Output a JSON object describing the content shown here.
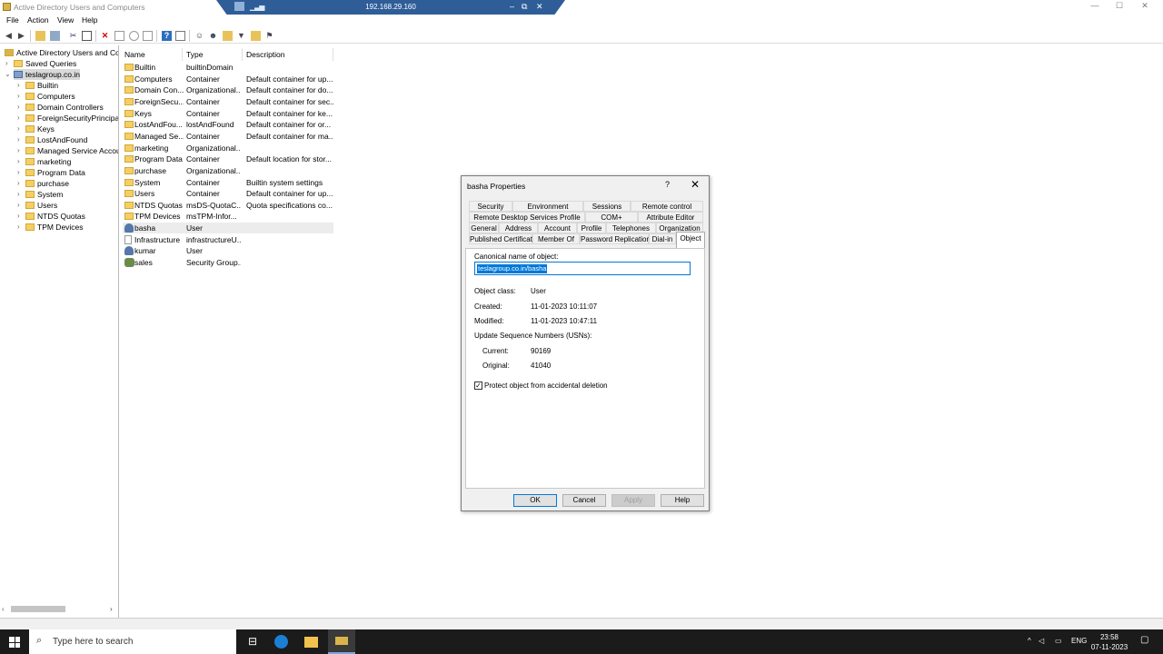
{
  "window": {
    "title": "Active Directory Users and Computers",
    "controls": {
      "minimize": "—",
      "maximize": "☐",
      "close": "✕"
    }
  },
  "rdp_bar": {
    "ip": "192.168.29.160",
    "signal": "▁▃▅",
    "controls": {
      "minimize": "–",
      "restore": "⧉",
      "close": "✕"
    }
  },
  "menu": [
    "File",
    "Action",
    "View",
    "Help"
  ],
  "tree": {
    "root": "Active Directory Users and Com",
    "saved_queries": "Saved Queries",
    "domain": "teslagroup.co.in",
    "children": [
      "Builtin",
      "Computers",
      "Domain Controllers",
      "ForeignSecurityPrincipals",
      "Keys",
      "LostAndFound",
      "Managed Service Accou",
      "marketing",
      "Program Data",
      "purchase",
      "System",
      "Users",
      "NTDS Quotas",
      "TPM Devices"
    ]
  },
  "list": {
    "columns": [
      "Name",
      "Type",
      "Description"
    ],
    "rows": [
      {
        "name": "Builtin",
        "type": "builtinDomain",
        "desc": "",
        "icon": "folder"
      },
      {
        "name": "Computers",
        "type": "Container",
        "desc": "Default container for up...",
        "icon": "folder"
      },
      {
        "name": "Domain Con...",
        "type": "Organizational...",
        "desc": "Default container for do...",
        "icon": "folder"
      },
      {
        "name": "ForeignSecu...",
        "type": "Container",
        "desc": "Default container for sec...",
        "icon": "folder"
      },
      {
        "name": "Keys",
        "type": "Container",
        "desc": "Default container for ke...",
        "icon": "folder"
      },
      {
        "name": "LostAndFou...",
        "type": "lostAndFound",
        "desc": "Default container for or...",
        "icon": "folder"
      },
      {
        "name": "Managed Se...",
        "type": "Container",
        "desc": "Default container for ma...",
        "icon": "folder"
      },
      {
        "name": "marketing",
        "type": "Organizational...",
        "desc": "",
        "icon": "folder"
      },
      {
        "name": "Program Data",
        "type": "Container",
        "desc": "Default location for stor...",
        "icon": "folder"
      },
      {
        "name": "purchase",
        "type": "Organizational...",
        "desc": "",
        "icon": "folder"
      },
      {
        "name": "System",
        "type": "Container",
        "desc": "Builtin system settings",
        "icon": "folder"
      },
      {
        "name": "Users",
        "type": "Container",
        "desc": "Default container for up...",
        "icon": "folder"
      },
      {
        "name": "NTDS Quotas",
        "type": "msDS-QuotaC...",
        "desc": "Quota specifications co...",
        "icon": "folder"
      },
      {
        "name": "TPM Devices",
        "type": "msTPM-Infor...",
        "desc": "",
        "icon": "folder"
      },
      {
        "name": "basha",
        "type": "User",
        "desc": "",
        "icon": "user"
      },
      {
        "name": "Infrastructure",
        "type": "infrastructureU...",
        "desc": "",
        "icon": "doc"
      },
      {
        "name": "kumar",
        "type": "User",
        "desc": "",
        "icon": "user"
      },
      {
        "name": "sales",
        "type": "Security Group...",
        "desc": "",
        "icon": "group"
      }
    ]
  },
  "dialog": {
    "title": "basha Properties",
    "help": "?",
    "close": "✕",
    "tabs_row1": [
      "Security",
      "Environment",
      "Sessions",
      "Remote control"
    ],
    "tabs_row2": [
      "Remote Desktop Services Profile",
      "COM+",
      "Attribute Editor"
    ],
    "tabs_row3": [
      "General",
      "Address",
      "Account",
      "Profile",
      "Telephones",
      "Organization"
    ],
    "tabs_row4": [
      "Published Certificates",
      "Member Of",
      "Password Replication",
      "Dial-in",
      "Object"
    ],
    "canonical_label": "Canonical name of object:",
    "canonical_value": "teslagroup.co.in/basha",
    "object_class_label": "Object class:",
    "object_class_value": "User",
    "created_label": "Created:",
    "created_value": "11-01-2023 10:11:07",
    "modified_label": "Modified:",
    "modified_value": "11-01-2023 10:47:11",
    "usn_label": "Update Sequence Numbers (USNs):",
    "current_label": "Current:",
    "current_value": "90169",
    "original_label": "Original:",
    "original_value": "41040",
    "protect_label": "Protect object from accidental deletion",
    "protect_mark": "✓",
    "protect_checked": true,
    "buttons": {
      "ok": "OK",
      "cancel": "Cancel",
      "apply": "Apply",
      "help": "Help"
    }
  },
  "taskbar": {
    "search_placeholder": "Type here to search",
    "search_icon": "⌕",
    "tray_arrow": "^",
    "language": "ENG",
    "time": "23:58",
    "date": "07-11-2023"
  }
}
